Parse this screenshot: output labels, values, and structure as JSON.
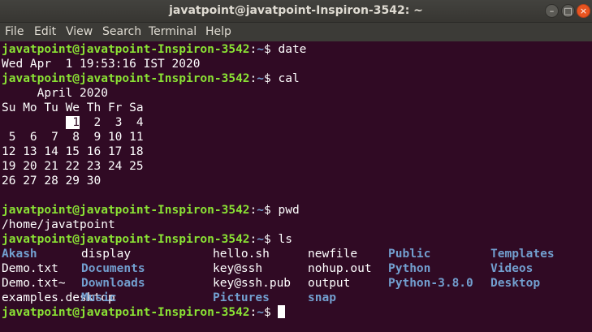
{
  "window": {
    "title": "javatpoint@javatpoint-Inspiron-3542: ~",
    "minimize_glyph": "–",
    "maximize_glyph": "□",
    "close_glyph": "×"
  },
  "menubar": {
    "items": [
      "File",
      "Edit",
      "View",
      "Search",
      "Terminal",
      "Help"
    ]
  },
  "prompt": {
    "user_host": "javatpoint@javatpoint-Inspiron-3542",
    "colon": ":",
    "path": "~",
    "symbol": "$"
  },
  "commands": {
    "date": {
      "cmd": " date",
      "output": "Wed Apr  1 19:53:16 IST 2020"
    },
    "cal": {
      "cmd": " cal",
      "header": "     April 2020",
      "weekdays": "Su Mo Tu We Th Fr Sa",
      "row1_prefix": "         ",
      "today": " 1",
      "row1_suffix": "  2  3  4",
      "rows": [
        " 5  6  7  8  9 10 11",
        "12 13 14 15 16 17 18",
        "19 20 21 22 23 24 25",
        "26 27 28 29 30"
      ]
    },
    "pwd": {
      "cmd": " pwd",
      "output": "/home/javatpoint"
    },
    "ls": {
      "cmd": " ls",
      "entries": [
        {
          "name": "Akash",
          "type": "dir"
        },
        {
          "name": "display",
          "type": "file"
        },
        {
          "name": "hello.sh",
          "type": "file"
        },
        {
          "name": "newfile",
          "type": "file"
        },
        {
          "name": "Public",
          "type": "dir"
        },
        {
          "name": "Templates",
          "type": "dir"
        },
        {
          "name": "Demo.txt",
          "type": "file"
        },
        {
          "name": "Documents",
          "type": "dir"
        },
        {
          "name": "key@ssh",
          "type": "file"
        },
        {
          "name": "nohup.out",
          "type": "file"
        },
        {
          "name": "Python",
          "type": "dir"
        },
        {
          "name": "Videos",
          "type": "dir"
        },
        {
          "name": "Demo.txt~",
          "type": "file"
        },
        {
          "name": "Downloads",
          "type": "dir"
        },
        {
          "name": "key@ssh.pub",
          "type": "file"
        },
        {
          "name": "output",
          "type": "file"
        },
        {
          "name": "Python-3.8.0",
          "type": "dir"
        },
        {
          "name": "Desktop",
          "type": "dir"
        },
        {
          "name": "examples.desktop",
          "type": "file"
        },
        {
          "name": "Music",
          "type": "dir"
        },
        {
          "name": "Pictures",
          "type": "dir"
        },
        {
          "name": "snap",
          "type": "dir"
        }
      ]
    }
  },
  "colors": {
    "background": "#300a24",
    "prompt_user": "#8ae234",
    "prompt_path": "#729fcf",
    "directory": "#729fcf",
    "text": "#ffffff"
  }
}
